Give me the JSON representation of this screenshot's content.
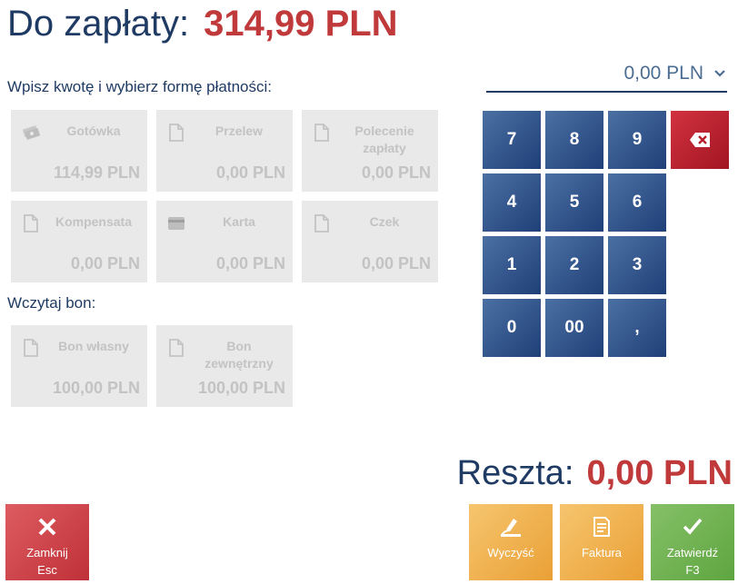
{
  "header": {
    "label": "Do zapłaty:",
    "amount": "314,99 PLN"
  },
  "payment_section": {
    "label": "Wpisz kwotę i wybierz formę płatności:"
  },
  "payment_methods": [
    {
      "name": "Gotówka",
      "value": "114,99 PLN",
      "icon": "cash-icon"
    },
    {
      "name": "Przelew",
      "value": "0,00 PLN",
      "icon": "document-icon"
    },
    {
      "name": "Polecenie\nzapłaty",
      "value": "0,00 PLN",
      "icon": "document-icon"
    },
    {
      "name": "Kompensata",
      "value": "0,00 PLN",
      "icon": "document-icon"
    },
    {
      "name": "Karta",
      "value": "0,00 PLN",
      "icon": "card-icon"
    },
    {
      "name": "Czek",
      "value": "0,00 PLN",
      "icon": "document-icon"
    }
  ],
  "voucher_section": {
    "label": "Wczytaj bon:"
  },
  "vouchers": [
    {
      "name": "Bon własny",
      "value": "100,00 PLN",
      "icon": "document-icon"
    },
    {
      "name": "Bon\nzewnętrzny",
      "value": "100,00 PLN",
      "icon": "document-icon"
    }
  ],
  "amount_input": {
    "value": "0,00 PLN",
    "icon": "chevron-down-icon"
  },
  "keypad": {
    "keys": [
      "7",
      "8",
      "9",
      "4",
      "5",
      "6",
      "1",
      "2",
      "3",
      "0",
      "00",
      ","
    ],
    "backspace_icon": "backspace-icon"
  },
  "change": {
    "label": "Reszta:",
    "amount": "0,00 PLN"
  },
  "actions": {
    "close": {
      "label": "Zamknij\nEsc",
      "icon": "close-icon"
    },
    "clear": {
      "label": "Wyczyść",
      "icon": "eraser-icon"
    },
    "invoice": {
      "label": "Faktura",
      "icon": "invoice-icon"
    },
    "confirm": {
      "label": "Zatwierdź\nF3",
      "icon": "checkmark-icon"
    }
  },
  "colors": {
    "primary_text": "#1f3b63",
    "amount_red": "#c0393b",
    "keypad_blue": "#2d4f88",
    "backspace_red": "#b81f2c",
    "tile_gray": "#e9e9e9",
    "close_red": "#cc444a",
    "action_orange": "#f0b04e",
    "confirm_green": "#72b354"
  }
}
